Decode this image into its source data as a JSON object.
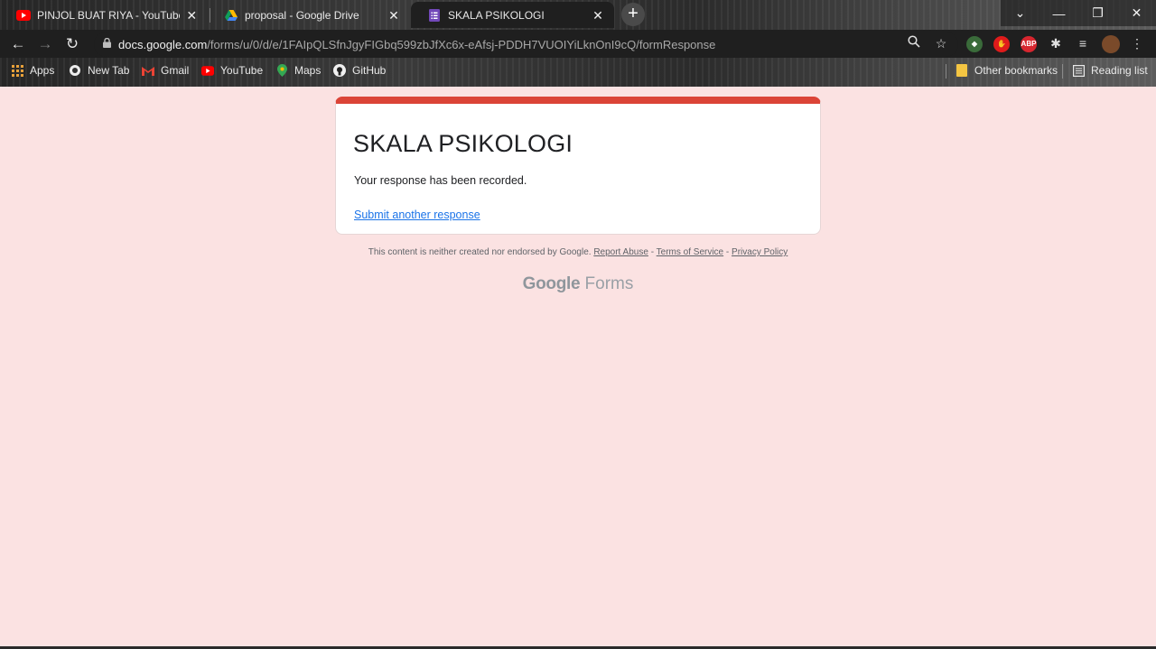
{
  "tabs": [
    {
      "title": "PINJOL BUAT RIYA - YouTube",
      "favicon": "youtube-icon",
      "active": false
    },
    {
      "title": "proposal - Google Drive",
      "favicon": "google-drive-icon",
      "active": false
    },
    {
      "title": "SKALA PSIKOLOGI",
      "favicon": "google-forms-icon",
      "active": true
    }
  ],
  "toolbar": {
    "url_host": "docs.google.com",
    "url_path": "/forms/u/0/d/e/1FAIpQLSfnJgyFIGbq599zbJfXc6x-eAfsj-PDDH7VUOIYiLknOnI9cQ/formResponse"
  },
  "bookmarks": {
    "items": [
      {
        "label": "Apps",
        "icon": "apps-grid-icon"
      },
      {
        "label": "New Tab",
        "icon": "globe-icon"
      },
      {
        "label": "Gmail",
        "icon": "gmail-icon"
      },
      {
        "label": "YouTube",
        "icon": "youtube-icon"
      },
      {
        "label": "Maps",
        "icon": "maps-pin-icon"
      },
      {
        "label": "GitHub",
        "icon": "github-icon"
      }
    ],
    "other": "Other bookmarks",
    "reading_list": "Reading list"
  },
  "form": {
    "title": "SKALA PSIKOLOGI",
    "message": "Your response has been recorded.",
    "link": "Submit another response",
    "accent_color": "#db4437"
  },
  "footer": {
    "disclaimer": "This content is neither created nor endorsed by Google.",
    "report_abuse": "Report Abuse",
    "sep1": "-",
    "terms": "Terms of Service",
    "sep2": "-",
    "privacy": "Privacy Policy",
    "brand_google": "Google",
    "brand_forms": "Forms"
  },
  "colors": {
    "page_background": "#fbe2e2",
    "link": "#1a73e8"
  }
}
